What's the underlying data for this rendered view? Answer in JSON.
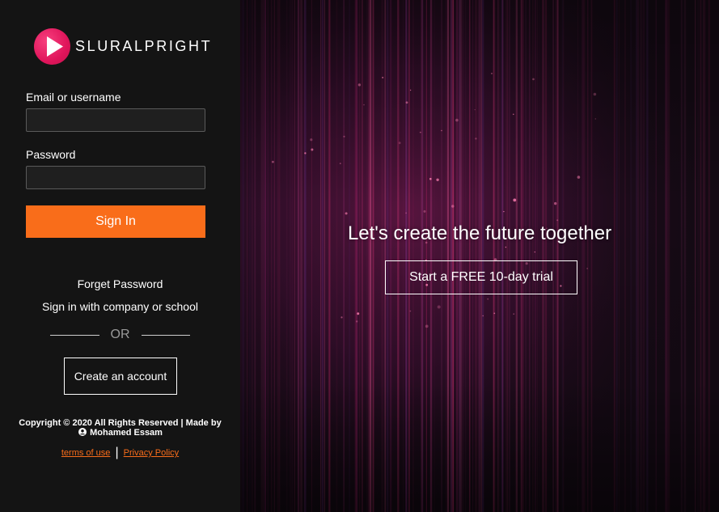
{
  "brand": {
    "name": "SLURALPRIGHT",
    "accent": "#f96d1a",
    "logo_color": "#e0155b"
  },
  "login": {
    "email_label": "Email or username",
    "email_value": "",
    "password_label": "Password",
    "password_value": "",
    "signin_label": "Sign In"
  },
  "links": {
    "forget_password": "Forget Password",
    "company_signin": "Sign in with company or school",
    "or": "OR",
    "create_account": "Create an account"
  },
  "footer": {
    "copyright": "Copyright © 2020 All Rights Reserved | Made by",
    "author": "Mohamed Essam",
    "author_icon": "user-circle-icon",
    "terms": "terms of use",
    "privacy": "Privacy Policy",
    "separator": "|"
  },
  "hero": {
    "title": "Let's create the future together",
    "trial_label": "Start a FREE 10-day trial"
  }
}
